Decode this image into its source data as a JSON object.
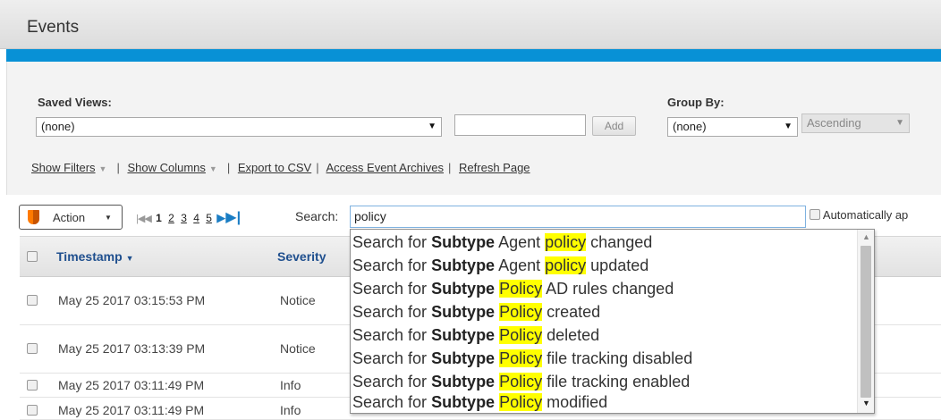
{
  "page": {
    "title": "Events",
    "accent_color": "#0891d6"
  },
  "toolbar": {
    "saved_views_label": "Saved Views:",
    "saved_views_value": "(none)",
    "add_label": "Add",
    "group_by_label": "Group By:",
    "group_by_value": "(none)",
    "sort_order_value": "Ascending"
  },
  "links": {
    "show_filters": "Show Filters",
    "show_columns": "Show Columns",
    "export_csv": "Export to CSV",
    "access_archives": "Access Event Archives",
    "refresh": "Refresh Page"
  },
  "actions": {
    "action_label": "Action"
  },
  "pager": {
    "current": "1",
    "pages": [
      "2",
      "3",
      "4",
      "5"
    ]
  },
  "search": {
    "label": "Search:",
    "value": "policy",
    "auto_apply_label": "Automatically ap"
  },
  "table": {
    "columns": {
      "timestamp": "Timestamp",
      "severity": "Severity"
    },
    "rows": [
      {
        "timestamp": "May 25 2017 03:15:53 PM",
        "severity": "Notice"
      },
      {
        "timestamp": "May 25 2017 03:13:39 PM",
        "severity": "Notice"
      },
      {
        "timestamp": "May 25 2017 03:11:49 PM",
        "severity": "Info"
      },
      {
        "timestamp": "May 25 2017 03:11:49 PM",
        "severity": "Info"
      }
    ]
  },
  "suggestions": {
    "prefix": "Search for",
    "field": "Subtype",
    "items": [
      {
        "before": "Agent ",
        "match": "policy",
        "after": " changed"
      },
      {
        "before": "Agent ",
        "match": "policy",
        "after": " updated"
      },
      {
        "before": "",
        "match": "Policy",
        "after": " AD rules changed"
      },
      {
        "before": "",
        "match": "Policy",
        "after": " created"
      },
      {
        "before": "",
        "match": "Policy",
        "after": " deleted"
      },
      {
        "before": "",
        "match": "Policy",
        "after": " file tracking disabled"
      },
      {
        "before": "",
        "match": "Policy",
        "after": " file tracking enabled"
      },
      {
        "before": "",
        "match": "Policy",
        "after": " modified"
      }
    ]
  }
}
